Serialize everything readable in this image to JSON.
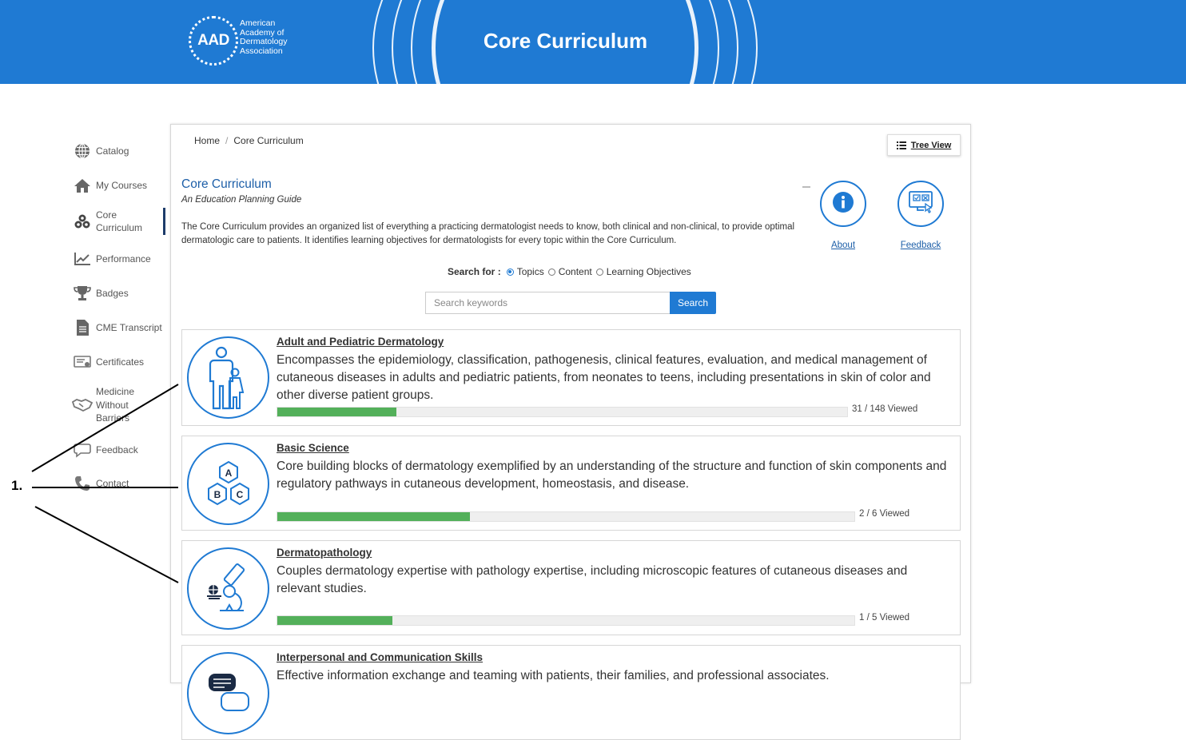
{
  "header": {
    "logo_mark": "AAD",
    "logo_lines": [
      "American",
      "Academy of",
      "Dermatology",
      "Association"
    ],
    "title": "Core Curriculum"
  },
  "sidebar": {
    "items": [
      {
        "label": "Catalog",
        "icon": "globe-icon"
      },
      {
        "label": "My Courses",
        "icon": "home-icon"
      },
      {
        "label": "Core Curriculum",
        "icon": "blocks-icon",
        "active": true
      },
      {
        "label": "Performance",
        "icon": "chart-icon"
      },
      {
        "label": "Badges",
        "icon": "trophy-icon"
      },
      {
        "label": "CME Transcript",
        "icon": "document-icon"
      },
      {
        "label": "Certificates",
        "icon": "certificate-icon"
      },
      {
        "label": "Medicine Without Barriers",
        "icon": "handshake-icon"
      },
      {
        "label": "Feedback",
        "icon": "speech-bubble-icon"
      },
      {
        "label": "Contact",
        "icon": "phone-icon"
      }
    ]
  },
  "breadcrumb": {
    "home": "Home",
    "separator": "/",
    "current": "Core Curriculum"
  },
  "tree_view": {
    "label": "Tree View",
    "icon": "list-icon"
  },
  "intro": {
    "title": "Core Curriculum",
    "subtitle": "An Education Planning Guide",
    "description": "The Core Curriculum provides an organized list of everything a practicing dermatologist needs to know, both clinical and non-clinical, to provide optimal dermatologic care to patients. It identifies learning objectives for dermatologists for every topic within the Core Curriculum."
  },
  "actions": {
    "about": {
      "label": "About",
      "icon": "info-icon"
    },
    "feedback": {
      "label": "Feedback",
      "icon": "feedback-monitor-icon"
    }
  },
  "search": {
    "label": "Search for :",
    "options": [
      "Topics",
      "Content",
      "Learning Objectives"
    ],
    "selected": "Topics",
    "placeholder": "Search keywords",
    "button": "Search"
  },
  "topics": [
    {
      "name": "Adult and Pediatric Dermatology",
      "description": "Encompasses the epidemiology, classification, pathogenesis, clinical features, evaluation, and medical management of cutaneous diseases in adults and pediatric patients, from neonates to teens, including presentations in skin of color and other diverse patient groups.",
      "progress": 0.2095,
      "count": "31 / 148 Viewed",
      "icon": "adult-child-icon"
    },
    {
      "name": "Basic Science",
      "description": "Core building blocks of dermatology exemplified by an understanding of the structure and function of skin components and regulatory pathways in cutaneous development, homeostasis, and disease.",
      "progress": 0.3333,
      "count": "2 / 6 Viewed",
      "icon": "abc-blocks-icon",
      "icon_letters": [
        "A",
        "B",
        "C"
      ]
    },
    {
      "name": "Dermatopathology",
      "description": "Couples dermatology expertise with pathology expertise, including microscopic features of cutaneous diseases and relevant studies.",
      "progress": 0.2,
      "count": "1 / 5 Viewed",
      "icon": "microscope-icon"
    },
    {
      "name": "Interpersonal and Communication Skills",
      "description": "Effective information exchange and teaming with patients, their families, and professional associates.",
      "icon": "speech-bubbles-icon"
    }
  ],
  "callout": {
    "label": "1."
  },
  "colors": {
    "brand_blue": "#1f7ad3",
    "progress_green": "#53b05a",
    "title_blue": "#1d5fa8"
  }
}
